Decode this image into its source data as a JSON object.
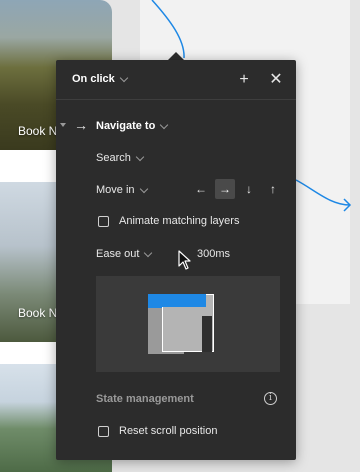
{
  "panel": {
    "trigger_label": "On click",
    "action_label": "Navigate to",
    "destination_label": "Search",
    "animation_label": "Move in",
    "animate_matching_label": "Animate matching layers",
    "easing_label": "Ease out",
    "duration_label": "300ms",
    "section_state_label": "State management",
    "reset_scroll_label": "Reset scroll position",
    "direction_selected": "right",
    "icons": {
      "add": "plus-icon",
      "close": "close-icon",
      "action": "arrow-right-icon",
      "info": "info-icon",
      "directions": [
        "arrow-left-icon",
        "arrow-right-icon",
        "arrow-down-icon",
        "arrow-up-icon"
      ]
    }
  },
  "canvas": {
    "frames": [
      {
        "label": "Book N"
      },
      {
        "label": "Book N"
      },
      {
        "label": ""
      }
    ],
    "connector_color": "#1e88e5"
  },
  "colors": {
    "panel_bg": "#2c2c2c",
    "accent": "#1e88e5",
    "canvas_bg": "#e5e5e5"
  }
}
